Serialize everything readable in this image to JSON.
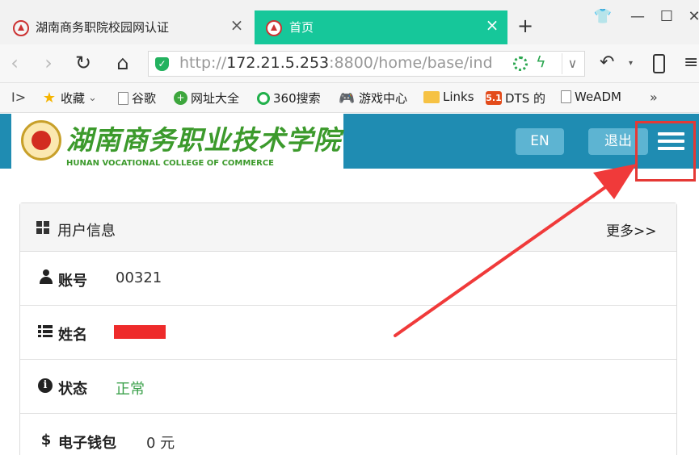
{
  "browser": {
    "tabs": [
      {
        "title": "湖南商务职院校园网认证",
        "close": "×",
        "active": false
      },
      {
        "title": "首页",
        "close": "×",
        "active": true
      }
    ],
    "new_tab": "+",
    "window_controls": {
      "skin": "👕",
      "minimize": "—",
      "maximize": "☐",
      "close": "✕"
    },
    "address": {
      "scheme": "http://",
      "host": "172.21.5.253",
      "rest": ":8800/home/base/ind",
      "security_icon": "shield-check-icon"
    },
    "toolbar": {
      "undo": "↶",
      "undo_dropdown": "▾",
      "menu": "≡",
      "url_dropdown": "∨"
    },
    "bookmarks": [
      {
        "label": "收藏",
        "icon": "star-icon",
        "arrow": "⌄"
      },
      {
        "label": "谷歌",
        "icon": "page-icon"
      },
      {
        "label": "网址大全",
        "icon": "plus-badge-icon"
      },
      {
        "label": "360搜索",
        "icon": "search-o-icon"
      },
      {
        "label": "游戏中心",
        "icon": "gamepad-icon"
      },
      {
        "label": "Links",
        "icon": "folder-icon"
      },
      {
        "label": "DTS 的",
        "icon": "badge-51-icon",
        "badge": "5.1"
      },
      {
        "label": "WeADM",
        "icon": "page-icon"
      }
    ],
    "bookmarks_more": "»",
    "sidebar_toggle": "I>"
  },
  "site": {
    "name_cn": "湖南商务职业技术学院",
    "name_en": "HUNAN VOCATIONAL COLLEGE OF COMMERCE",
    "lang_button": "EN",
    "logout_button": "退出",
    "colors": {
      "header": "#1f8cb2",
      "button": "#5db4d2",
      "logo_text": "#3c9a2c",
      "highlight": "#e53935",
      "status_ok": "#3aa04a"
    }
  },
  "panel": {
    "title": "用户信息",
    "more": "更多>>",
    "rows": [
      {
        "label": "账号",
        "value": "00321",
        "icon": "user-icon"
      },
      {
        "label": "姓名",
        "value": "",
        "icon": "list-icon",
        "redacted": true
      },
      {
        "label": "状态",
        "value": "正常",
        "icon": "info-icon"
      },
      {
        "label": "电子钱包",
        "value": "0 元",
        "icon": "dollar-icon",
        "icon_glyph": "$"
      }
    ]
  },
  "annotation": {
    "info_glyph": "i"
  }
}
